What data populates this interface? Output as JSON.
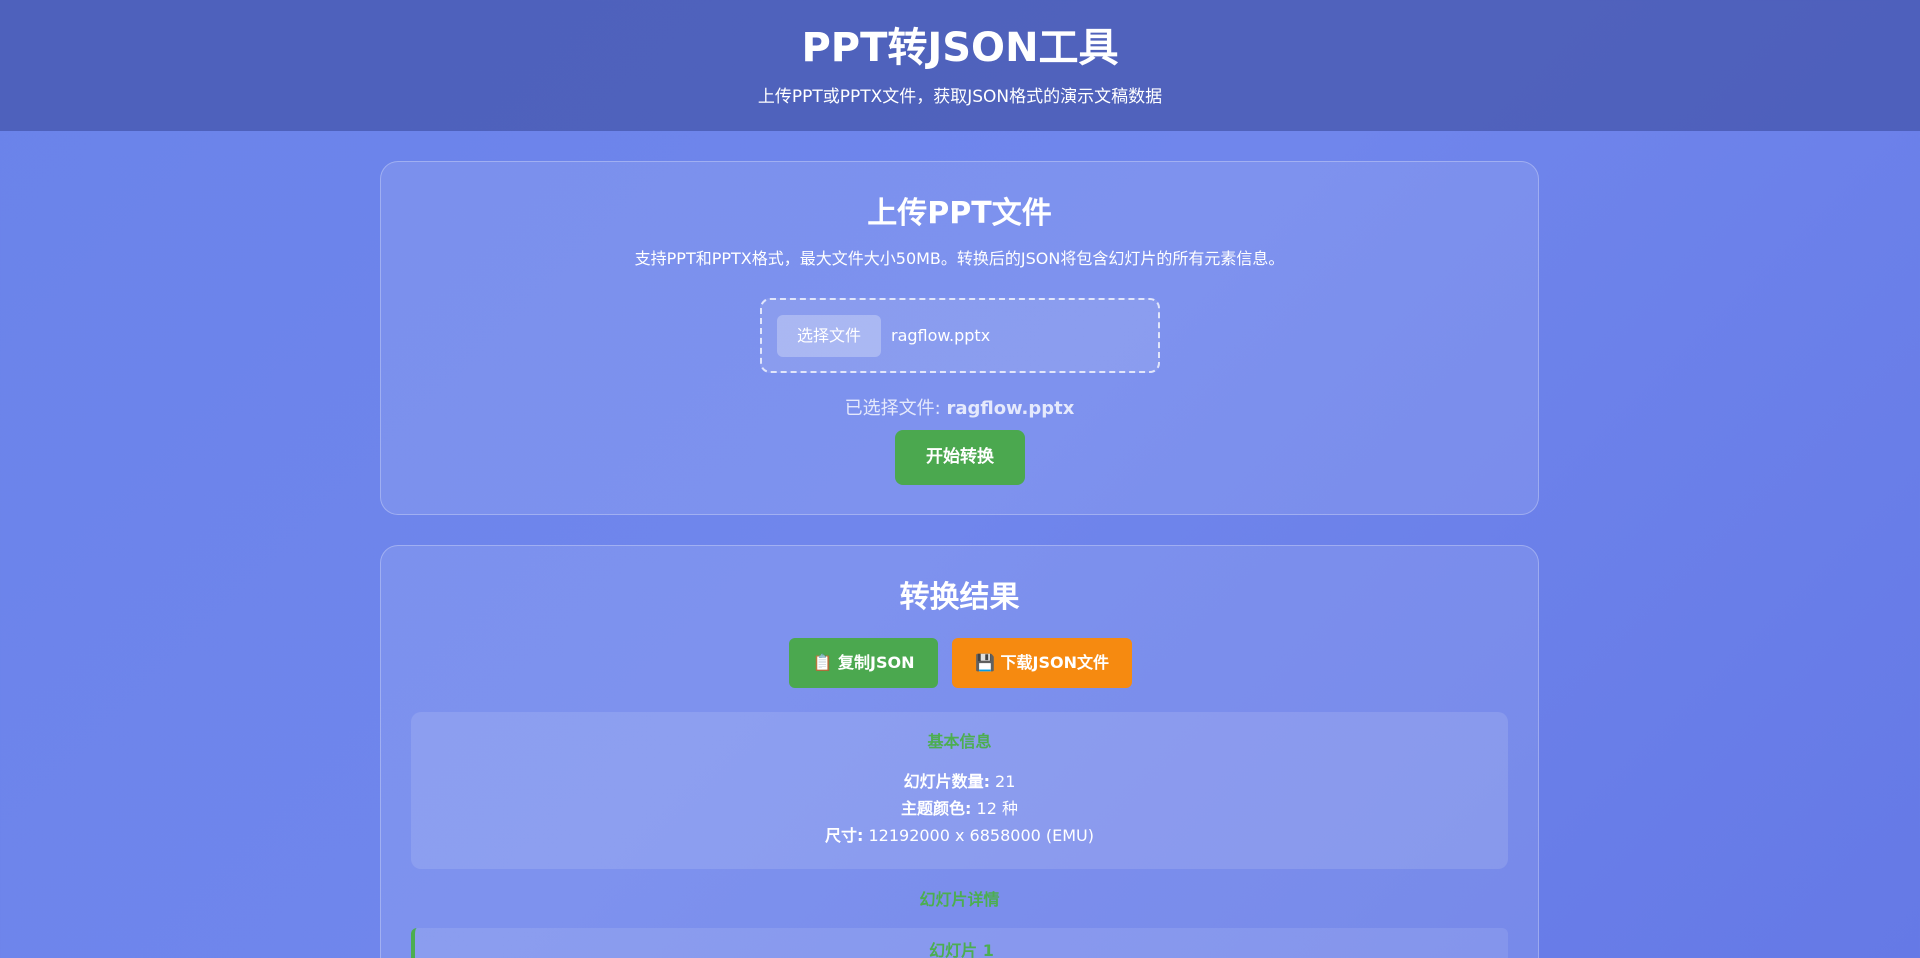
{
  "header": {
    "title": "PPT转JSON工具",
    "subtitle": "上传PPT或PPTX文件，获取JSON格式的演示文稿数据"
  },
  "upload": {
    "title": "上传PPT文件",
    "description": "支持PPT和PPTX格式，最大文件大小50MB。转换后的JSON将包含幻灯片的所有元素信息。",
    "choose_label": "选择文件",
    "file_name": "ragflow.pptx",
    "selected_prefix": "已选择文件: ",
    "selected_file": "ragflow.pptx",
    "convert_label": "开始转换"
  },
  "result": {
    "title": "转换结果",
    "copy_label": "📋 复制JSON",
    "download_label": "💾 下载JSON文件",
    "basic_info": {
      "title": "基本信息",
      "slides_label": "幻灯片数量:",
      "slides_value": " 21",
      "theme_label": "主题颜色:",
      "theme_value": " 12 种",
      "size_label": "尺寸:",
      "size_value": " 12192000 x 6858000 (EMU)"
    },
    "details_title": "幻灯片详情",
    "slides": [
      {
        "title": "幻灯片 1"
      }
    ]
  },
  "colors": {
    "accent_green": "#4ba84f",
    "accent_orange": "#f68a10",
    "background": "#6a83ea"
  }
}
